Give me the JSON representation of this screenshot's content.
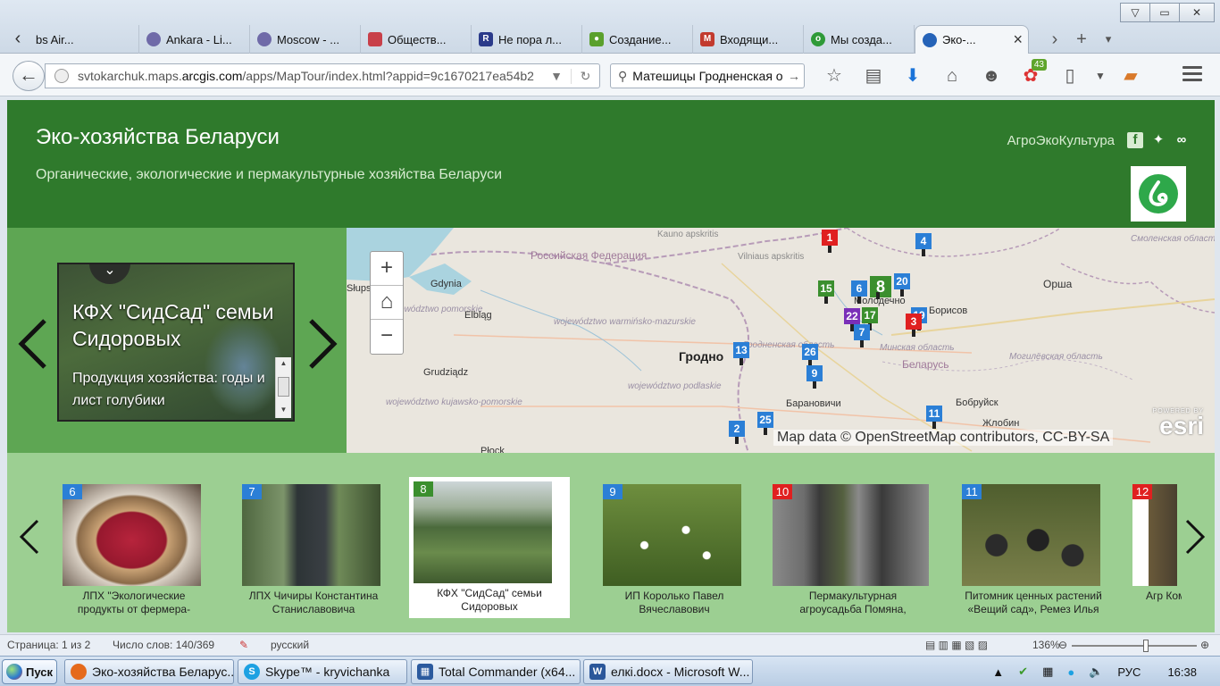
{
  "window": {
    "minimize": "▽",
    "restore": "▭",
    "close": "✕"
  },
  "tabs": [
    {
      "label": "bs Air...",
      "color": "#6a7a9a"
    },
    {
      "label": "Ankara - Li...",
      "color": "#6f6aa8"
    },
    {
      "label": "Moscow - ...",
      "color": "#6f6aa8"
    },
    {
      "label": "Обществ...",
      "color": "#c8404a"
    },
    {
      "label": "Не пора л...",
      "color": "#2a3a8a"
    },
    {
      "label": "Создание...",
      "color": "#5aa02c"
    },
    {
      "label": "Входящи...",
      "color": "#c23a2e"
    },
    {
      "label": "Мы созда...",
      "color": "#2e9a38"
    },
    {
      "label": "Эко-...",
      "color": "#2563b8",
      "active": true
    }
  ],
  "tab_tools": {
    "forward": "›",
    "new_tab": "+",
    "list": "▾"
  },
  "navbar": {
    "url_prefix": "svtokarchuk.maps.",
    "url_domain": "arcgis.com",
    "url_rest": "/apps/MapTour/index.html?appid=9c1670217ea54b2",
    "search_value": "Матешицы Гродненская о",
    "addon_badge": "43"
  },
  "header": {
    "title": "Эко-хозяйства Беларуси",
    "subtitle": "Органические, экологические и пермакультурные хозяйства Беларуси",
    "link": "АгроЭкоКультура"
  },
  "card": {
    "title": "КФХ \"СидСад\" семьи Сидоровых",
    "body": "Продукция хозяйства: годы и лист голубики"
  },
  "map": {
    "labels": {
      "kaunas": "Kauno apskritis",
      "vilnius": "Vilniaus apskritis",
      "russia": "Российская Федерация",
      "slupsk": "Słups",
      "gdynia": "Gdynia",
      "pomorskie": "województwo pomorskie",
      "elblag": "Elbląg",
      "warminsko": "województwo warmińsko-mazurskie",
      "grodno": "Гродно",
      "grodno_obl": "Гродненская область",
      "grudziadz": "Grudziądz",
      "podlaskie": "województwo podlaskie",
      "kujawsko": "województwo kujawsko-pomorskie",
      "baranovichi": "Барановичи",
      "bobruisk": "Бобруйск",
      "zhlobin": "Жлобин",
      "minsk_obl": "Минская область",
      "belarus": "Беларусь",
      "borisov": "Борисов",
      "molodechno": "Молодечно",
      "mogilev_obl": "Могилёвская область",
      "orsha": "Орша",
      "smolensk_obl": "Смоленская область",
      "plock": "Płock"
    },
    "attribution": "Map data © OpenStreetMap contributors, CC-BY-SA",
    "powered": "POWERED BY",
    "esri": "esri"
  },
  "pins": [
    {
      "num": "1",
      "color": "red"
    },
    {
      "num": "4",
      "color": "blue"
    },
    {
      "num": "15",
      "color": "green"
    },
    {
      "num": "6",
      "color": "blue"
    },
    {
      "num": "8",
      "color": "green"
    },
    {
      "num": "20",
      "color": "blue"
    },
    {
      "num": "22",
      "color": "purple"
    },
    {
      "num": "17",
      "color": "green"
    },
    {
      "num": "19",
      "color": "blue"
    },
    {
      "num": "3",
      "color": "red"
    },
    {
      "num": "7",
      "color": "blue"
    },
    {
      "num": "13",
      "color": "blue"
    },
    {
      "num": "26",
      "color": "blue"
    },
    {
      "num": "9",
      "color": "blue"
    },
    {
      "num": "11",
      "color": "blue"
    },
    {
      "num": "25",
      "color": "blue"
    },
    {
      "num": "2",
      "color": "blue"
    }
  ],
  "carousel": [
    {
      "num": "6",
      "color": "blue",
      "caption": "ЛПХ \"Экологические продукты от фермера-",
      "img": "pie"
    },
    {
      "num": "7",
      "color": "blue",
      "caption": "ЛПХ Чичиры Константина Станиславовича",
      "img": "man"
    },
    {
      "num": "8",
      "color": "green",
      "caption": "КФХ \"СидСад\" семьи Сидоровых",
      "img": "field",
      "selected": true
    },
    {
      "num": "9",
      "color": "blue",
      "caption": "ИП Королько Павел Вячеславович",
      "img": "daisy"
    },
    {
      "num": "10",
      "color": "red",
      "caption": "Пермакультурная агроусадьба Помяна,",
      "img": "people"
    },
    {
      "num": "11",
      "color": "blue",
      "caption": "Питомник ценных растений «Вещий сад», Ремез Илья",
      "img": "pots"
    },
    {
      "num": "12",
      "color": "red",
      "caption": "Агр Комар",
      "img": "partial"
    }
  ],
  "wordbar": {
    "page": "Страница: 1 из 2",
    "words": "Число слов: 140/369",
    "lang": "русский",
    "zoom": "136%"
  },
  "taskbar": {
    "start": "Пуск",
    "tasks": [
      {
        "label": "Эко-хозяйства Беларус...",
        "color": "#e56a1c"
      },
      {
        "label": "Skype™ - kryvichanka",
        "color": "#1da1e2"
      },
      {
        "label": "Total Commander (x64...",
        "color": "#2b5a9e"
      },
      {
        "label": "елкі.docx - Microsoft W...",
        "color": "#2b579a"
      }
    ],
    "lang": "РУС",
    "time": "16:38"
  }
}
